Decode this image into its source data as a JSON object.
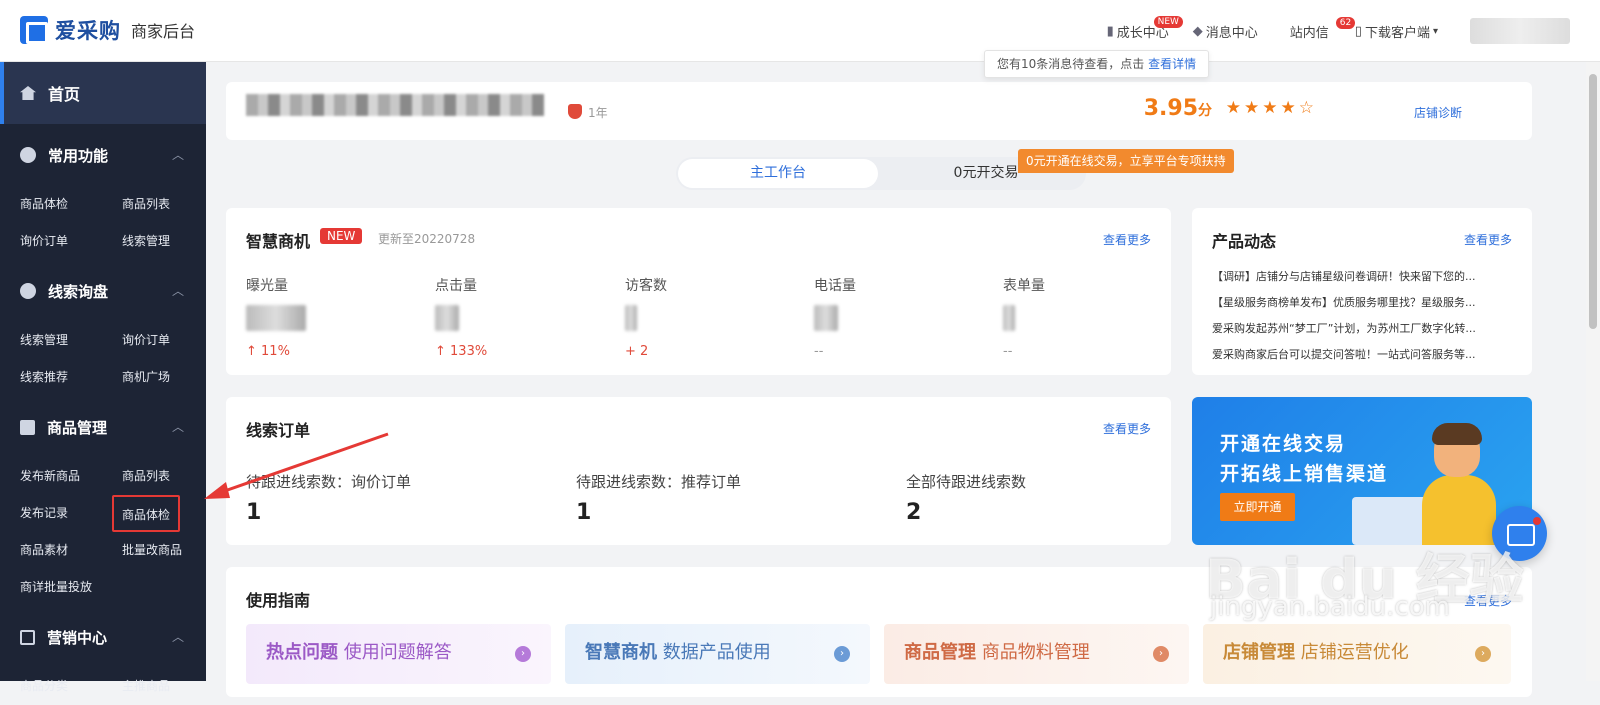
{
  "header": {
    "logo_text": "爱采购",
    "logo_sub": "商家后台",
    "nav": [
      {
        "label": "成长中心",
        "badge": "NEW"
      },
      {
        "label": "消息中心"
      },
      {
        "label": "站内信",
        "badge": "62"
      },
      {
        "label": "下载客户端"
      }
    ],
    "tooltip_text": "您有10条消息待查看，点击",
    "tooltip_link": "查看详情"
  },
  "sidebar": {
    "home": "首页",
    "groups": [
      {
        "title": "常用功能",
        "items": [
          "商品体检",
          "商品列表",
          "询价订单",
          "线索管理"
        ]
      },
      {
        "title": "线索询盘",
        "items": [
          "线索管理",
          "询价订单",
          "线索推荐",
          "商机广场"
        ]
      },
      {
        "title": "商品管理",
        "items": [
          "发布新商品",
          "商品列表",
          "发布记录",
          "商品体检",
          "商品素材",
          "批量改商品",
          "商详批量投放"
        ]
      },
      {
        "title": "营销中心",
        "items": [
          "商品分类",
          "主推商品"
        ]
      }
    ]
  },
  "shop": {
    "years": "1年",
    "score": "3.95",
    "score_unit": "分",
    "stars": "★★★★☆",
    "diagnose": "店铺诊断"
  },
  "tabs": {
    "main": "主工作台",
    "second": "0元开交易",
    "promo": "0元开通在线交易，立享平台专项扶持"
  },
  "biz": {
    "title": "智慧商机",
    "tag": "NEW",
    "update": "更新至20220728",
    "more": "查看更多",
    "metrics": [
      {
        "label": "曝光量",
        "change": "↑ 11%"
      },
      {
        "label": "点击量",
        "change": "↑ 133%"
      },
      {
        "label": "访客数",
        "change": "+ 2"
      },
      {
        "label": "电话量",
        "change": "--"
      },
      {
        "label": "表单量",
        "change": "--"
      }
    ]
  },
  "news": {
    "title": "产品动态",
    "more": "查看更多",
    "items": [
      "【调研】店铺分与店铺星级问卷调研！快来留下您的...",
      "【星级服务商榜单发布】优质服务哪里找？星级服务...",
      "爱采购发起苏州“梦工厂”计划，为苏州工厂数字化转...",
      "爱采购商家后台可以提交问答啦！一站式问答服务等..."
    ]
  },
  "leads": {
    "title": "线索订单",
    "more": "查看更多",
    "cols": [
      {
        "label": "待跟进线索数：询价订单",
        "value": "1"
      },
      {
        "label": "待跟进线索数：推荐订单",
        "value": "1"
      },
      {
        "label": "全部待跟进线索数",
        "value": "2"
      }
    ]
  },
  "banner": {
    "line1": "开通在线交易",
    "line2": "开拓线上销售渠道",
    "button": "立即开通"
  },
  "guide": {
    "title": "使用指南",
    "more": "查看更多",
    "cards": [
      {
        "bold": "热点问题",
        "text": "使用问题解答"
      },
      {
        "bold": "智慧商机",
        "text": "数据产品使用"
      },
      {
        "bold": "商品管理",
        "text": "商品物料管理"
      },
      {
        "bold": "店铺管理",
        "text": "店铺运营优化"
      }
    ]
  },
  "watermark": {
    "main": "Bai du 经验",
    "sub": "jingyan.baidu.com"
  }
}
